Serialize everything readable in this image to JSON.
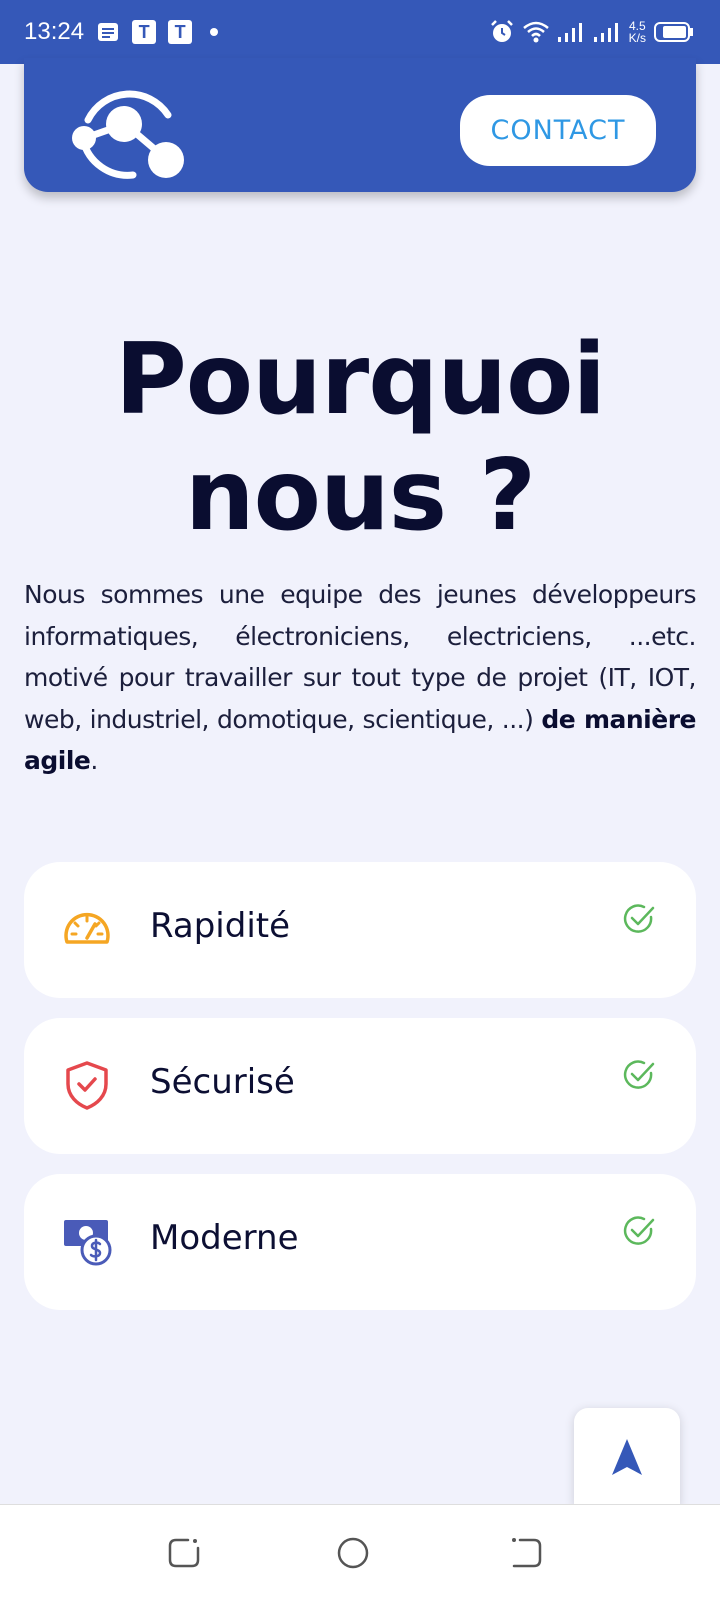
{
  "status_bar": {
    "time": "13:24",
    "icons": [
      "notes-icon",
      "t-app-icon",
      "t-app-icon",
      "dot-icon"
    ],
    "t_letter": "T",
    "speed_value": "4.5",
    "speed_unit": "K/s",
    "right_icons": [
      "alarm-icon",
      "wifi-icon",
      "signal-icon",
      "signal-icon",
      "battery-icon"
    ]
  },
  "header": {
    "logo_icon": "share-network-logo",
    "contact_label": "CONTACT"
  },
  "main": {
    "title_line1": "Pourquoi",
    "title_line2": "nous ?",
    "intro_text": "Nous sommes une equipe des jeunes développeurs informatiques, électroniciens, electriciens, ...etc. motivé pour travailler sur tout type de projet (IT, IOT, web, industriel, domotique, scientique, ...) ",
    "intro_bold": "de manière agile",
    "intro_end": "."
  },
  "features": [
    {
      "label": "Rapidité",
      "icon": "speedometer-icon",
      "color": "#f5a623"
    },
    {
      "label": "Sécurisé",
      "icon": "shield-check-icon",
      "color": "#e5484d"
    },
    {
      "label": "Moderne",
      "icon": "money-icon",
      "color": "#4a5bb8"
    }
  ],
  "check_color": "#5cb85c",
  "scroll_top_icon": "arrow-up-icon",
  "nav": [
    "recents-icon",
    "home-icon",
    "back-icon"
  ]
}
